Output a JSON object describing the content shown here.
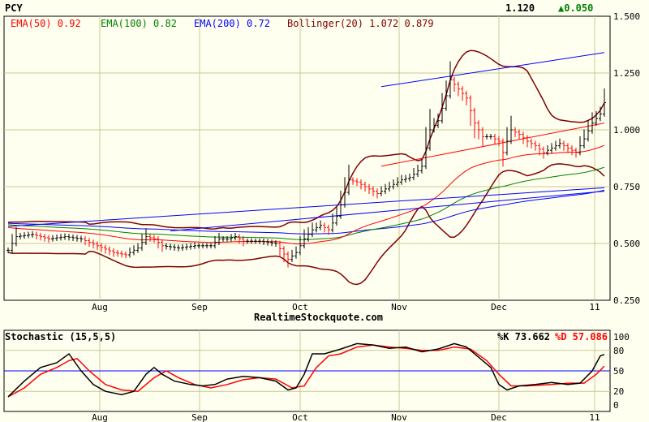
{
  "header": {
    "symbol": "PCY",
    "last": "1.120",
    "change": "▲0.050",
    "source": "RealtimeStockquote.com"
  },
  "legend": {
    "ema50": "EMA(50) 0.92",
    "ema100": "EMA(100) 0.82",
    "ema200": "EMA(200) 0.72",
    "boll": "Bollinger(20) 1.072 0.879"
  },
  "colors": {
    "ema50": "#ff0000",
    "ema100": "#008000",
    "ema200": "#0000ff",
    "boll": "#800000",
    "grid": "#c8c890",
    "up": "#008000"
  },
  "stoch": {
    "title": "Stochastic (15,5,5)",
    "k": "%K 73.662",
    "d": "%D 57.086"
  },
  "chart_data": [
    {
      "type": "line",
      "title": "PCY",
      "ylim": [
        0.25,
        1.5
      ],
      "yticks": [
        "1.500",
        "1.250",
        "1.000",
        "0.750",
        "0.500",
        "0.250"
      ],
      "ytick_values": [
        1.5,
        1.25,
        1.0,
        0.75,
        0.5,
        0.25
      ],
      "xticks": [
        {
          "label": "Aug",
          "day": 22.6
        },
        {
          "label": "Sep",
          "day": 47.2
        },
        {
          "label": "Oct",
          "day": 72
        },
        {
          "label": "Nov",
          "day": 96.4
        },
        {
          "label": "Dec",
          "day": 121
        },
        {
          "label": "11",
          "day": 144.6
        }
      ],
      "ema_start": {
        "ema50": 0.575,
        "ema100": 0.585,
        "ema200": 0.59
      },
      "close": [
        [
          0,
          0.47
        ],
        [
          2,
          0.53
        ],
        [
          6,
          0.54
        ],
        [
          10,
          0.52
        ],
        [
          14,
          0.53
        ],
        [
          18,
          0.52
        ],
        [
          22,
          0.49
        ],
        [
          26,
          0.46
        ],
        [
          29,
          0.45
        ],
        [
          32,
          0.48
        ],
        [
          34,
          0.53
        ],
        [
          36,
          0.52
        ],
        [
          38,
          0.49
        ],
        [
          42,
          0.48
        ],
        [
          46,
          0.49
        ],
        [
          50,
          0.49
        ],
        [
          52,
          0.52
        ],
        [
          54,
          0.52
        ],
        [
          56,
          0.53
        ],
        [
          58,
          0.51
        ],
        [
          62,
          0.51
        ],
        [
          66,
          0.5
        ],
        [
          69,
          0.43
        ],
        [
          71,
          0.46
        ],
        [
          73,
          0.52
        ],
        [
          75,
          0.56
        ],
        [
          77,
          0.58
        ],
        [
          79,
          0.56
        ],
        [
          81,
          0.62
        ],
        [
          82,
          0.67
        ],
        [
          84,
          0.78
        ],
        [
          86,
          0.77
        ],
        [
          88,
          0.75
        ],
        [
          91,
          0.72
        ],
        [
          93,
          0.74
        ],
        [
          95,
          0.76
        ],
        [
          97,
          0.78
        ],
        [
          99,
          0.79
        ],
        [
          101,
          0.82
        ],
        [
          102,
          0.84
        ],
        [
          104,
          1.0
        ],
        [
          106,
          1.04
        ],
        [
          108,
          1.15
        ],
        [
          109,
          1.22
        ],
        [
          111,
          1.18
        ],
        [
          113,
          1.14
        ],
        [
          115,
          1.03
        ],
        [
          117,
          0.97
        ],
        [
          119,
          0.97
        ],
        [
          121,
          0.95
        ],
        [
          122,
          0.9
        ],
        [
          124,
          1.0
        ],
        [
          126,
          0.98
        ],
        [
          128,
          0.95
        ],
        [
          130,
          0.93
        ],
        [
          132,
          0.9
        ],
        [
          134,
          0.92
        ],
        [
          136,
          0.94
        ],
        [
          138,
          0.92
        ],
        [
          140,
          0.9
        ],
        [
          142,
          0.96
        ],
        [
          144,
          1.03
        ],
        [
          146,
          1.07
        ],
        [
          147,
          1.12
        ]
      ],
      "trendlines": [
        {
          "color": "#0000ff",
          "from": [
            92,
            1.19
          ],
          "to": [
            147,
            1.34
          ]
        },
        {
          "color": "#ff0000",
          "from": [
            92,
            0.84
          ],
          "to": [
            147,
            1.03
          ]
        },
        {
          "color": "#0000ff",
          "from": [
            0,
            0.575
          ],
          "to": [
            147,
            0.745
          ]
        },
        {
          "color": "#0000ff",
          "from": [
            40,
            0.555
          ],
          "to": [
            147,
            0.73
          ]
        }
      ]
    },
    {
      "type": "line",
      "title": "Stochastic (15,5,5)",
      "ylim": [
        0,
        100
      ],
      "yticks": [
        "100",
        "80",
        "50",
        "20",
        "0"
      ],
      "ytick_values": [
        100,
        80,
        50,
        20,
        0
      ],
      "k": [
        [
          0,
          12
        ],
        [
          4,
          35
        ],
        [
          8,
          55
        ],
        [
          12,
          62
        ],
        [
          15,
          75
        ],
        [
          18,
          50
        ],
        [
          21,
          30
        ],
        [
          24,
          20
        ],
        [
          28,
          15
        ],
        [
          31,
          20
        ],
        [
          34,
          45
        ],
        [
          36,
          55
        ],
        [
          38,
          45
        ],
        [
          41,
          35
        ],
        [
          45,
          30
        ],
        [
          48,
          28
        ],
        [
          51,
          30
        ],
        [
          54,
          38
        ],
        [
          58,
          42
        ],
        [
          62,
          40
        ],
        [
          66,
          35
        ],
        [
          69,
          22
        ],
        [
          71,
          25
        ],
        [
          73,
          45
        ],
        [
          75,
          75
        ],
        [
          78,
          75
        ],
        [
          82,
          82
        ],
        [
          86,
          90
        ],
        [
          90,
          88
        ],
        [
          94,
          83
        ],
        [
          98,
          85
        ],
        [
          102,
          78
        ],
        [
          106,
          82
        ],
        [
          110,
          90
        ],
        [
          113,
          85
        ],
        [
          116,
          70
        ],
        [
          119,
          55
        ],
        [
          121,
          30
        ],
        [
          123,
          22
        ],
        [
          126,
          28
        ],
        [
          130,
          30
        ],
        [
          134,
          33
        ],
        [
          138,
          30
        ],
        [
          141,
          32
        ],
        [
          144,
          50
        ],
        [
          146,
          72
        ],
        [
          147,
          74
        ]
      ],
      "d": [
        [
          0,
          12
        ],
        [
          4,
          25
        ],
        [
          8,
          45
        ],
        [
          12,
          55
        ],
        [
          15,
          65
        ],
        [
          17,
          68
        ],
        [
          20,
          50
        ],
        [
          24,
          30
        ],
        [
          28,
          22
        ],
        [
          32,
          20
        ],
        [
          36,
          40
        ],
        [
          39,
          50
        ],
        [
          42,
          40
        ],
        [
          46,
          30
        ],
        [
          50,
          25
        ],
        [
          54,
          30
        ],
        [
          58,
          37
        ],
        [
          62,
          40
        ],
        [
          66,
          38
        ],
        [
          70,
          25
        ],
        [
          73,
          28
        ],
        [
          76,
          55
        ],
        [
          79,
          72
        ],
        [
          82,
          75
        ],
        [
          86,
          85
        ],
        [
          90,
          88
        ],
        [
          94,
          85
        ],
        [
          98,
          83
        ],
        [
          102,
          80
        ],
        [
          106,
          80
        ],
        [
          110,
          85
        ],
        [
          114,
          82
        ],
        [
          118,
          65
        ],
        [
          121,
          45
        ],
        [
          124,
          28
        ],
        [
          128,
          28
        ],
        [
          134,
          30
        ],
        [
          138,
          32
        ],
        [
          142,
          32
        ],
        [
          145,
          45
        ],
        [
          147,
          57
        ]
      ]
    }
  ]
}
